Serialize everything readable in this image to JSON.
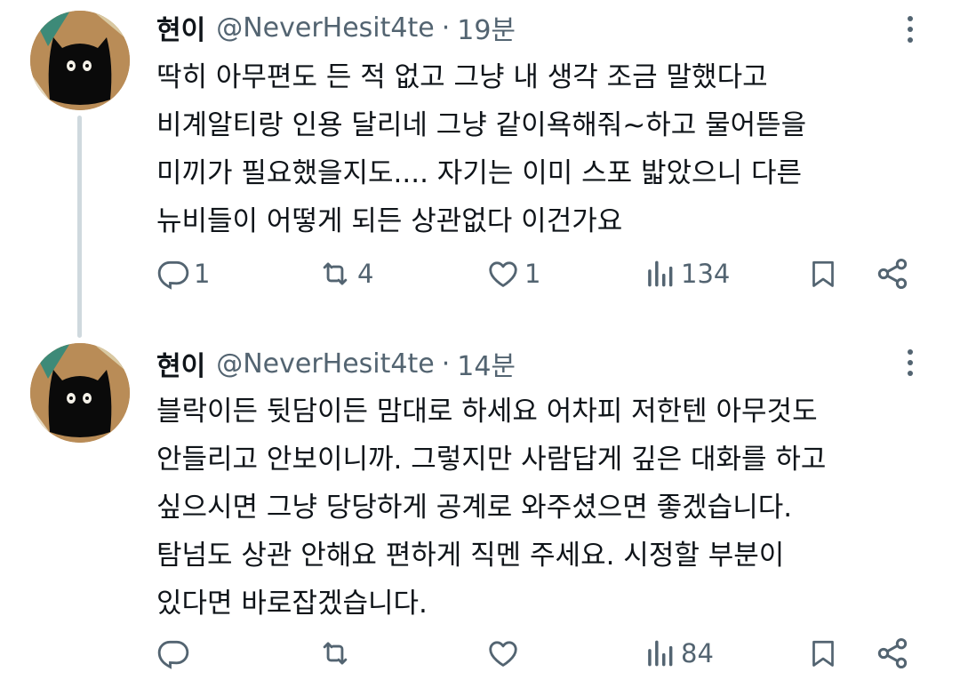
{
  "tweets": [
    {
      "author": {
        "name": "현이",
        "handle": "@NeverHesit4te"
      },
      "separator": "·",
      "time": "19분",
      "lines": [
        "딱히 아무편도 든 적 없고 그냥 내 생각 조금 말했다고",
        "비계알티랑 인용 달리네 그냥 같이욕해줘~하고 물어뜯을",
        "미끼가 필요했을지도.... 자기는 이미 스포 밟았으니 다른",
        "뉴비들이 어떻게 되든 상관없다 이건가요"
      ],
      "stats": {
        "replies": "1",
        "retweets": "4",
        "likes": "1",
        "views": "134"
      }
    },
    {
      "author": {
        "name": "현이",
        "handle": "@NeverHesit4te"
      },
      "separator": "·",
      "time": "14분",
      "lines": [
        "블락이든 뒷담이든 맘대로 하세요 어차피 저한텐 아무것도",
        "안들리고 안보이니까. 그렇지만 사람답게 깊은 대화를 하고",
        "싶으시면 그냥 당당하게 공계로 와주셨으면 좋겠습니다.",
        "탐넘도 상관 안해요 편하게 직멘 주세요. 시정할 부분이",
        "있다면 바로잡겠습니다."
      ],
      "stats": {
        "replies": "",
        "retweets": "",
        "likes": "",
        "views": "84"
      }
    }
  ],
  "icons": {
    "reply": "reply-icon",
    "retweet": "retweet-icon",
    "like": "heart-icon",
    "views": "views-icon",
    "bookmark": "bookmark-icon",
    "share": "share-icon",
    "more": "more-icon"
  },
  "colors": {
    "text": "#0f1419",
    "secondary": "#536471",
    "thread_line": "#cfd9de"
  }
}
